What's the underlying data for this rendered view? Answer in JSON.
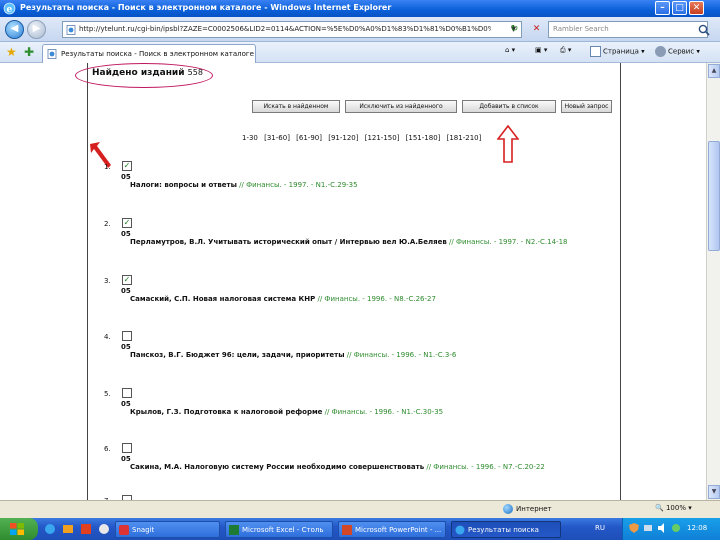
{
  "window": {
    "title": "Результаты поиска - Поиск в электронном каталоге - Windows Internet Explorer"
  },
  "address": {
    "url": "http://ytelunt.ru/cgi-bin/ipsbl?ZAZE=C0002506&LID2=0114&ACTION=%5E%D0%A0%D1%83%D1%81%D0%B1%D0%BE",
    "search_placeholder": "Rambler Search"
  },
  "tab": {
    "label": "Результаты поиска - Поиск в электронном каталоге"
  },
  "command_bar": {
    "page_label": "Страница",
    "tools_label": "Сервис"
  },
  "page": {
    "found_label": "Найдено изданий",
    "found_count": "558",
    "buttons": [
      {
        "label": "Искать в найденном"
      },
      {
        "label": "Исключить из найденного"
      },
      {
        "label": "Добавить в список"
      },
      {
        "label": "Новый запрос"
      }
    ],
    "pages": [
      "1-30",
      "[31-60]",
      "[61-90]",
      "[91-120]",
      "[121-150]",
      "[151-180]",
      "[181-210]"
    ],
    "records": [
      {
        "num": "1.",
        "checked": true,
        "code": "05",
        "text": "Налоги: вопросы и ответы",
        "source": " // Финансы. - 1997. - N1.-С.29-35"
      },
      {
        "num": "2.",
        "checked": true,
        "code": "05",
        "text": "Перламутров, В.Л. Учитывать исторический опыт / Интервью вел Ю.А.Беляев",
        "source": " // Финансы. - 1997. - N2.-С.14-18"
      },
      {
        "num": "3.",
        "checked": true,
        "code": "05",
        "text": "Самаский, С.П. Новая налоговая система КНР",
        "source": " // Финансы. - 1996. - N8.-С.26-27"
      },
      {
        "num": "4.",
        "checked": false,
        "code": "05",
        "text": "Панскоз, В.Г. Бюджет 96: цели, задачи, приоритеты",
        "source": " // Финансы. - 1996. - N1.-С.3-6"
      },
      {
        "num": "5.",
        "checked": false,
        "code": "05",
        "text": "Крылов, Г.З. Подготовка к налоговой реформе",
        "source": " // Финансы. - 1996. - N1.-С.30-35"
      },
      {
        "num": "6.",
        "checked": false,
        "code": "05",
        "text": "Сакина, М.А. Налоговую систему России необходимо совершенствовать",
        "source": " // Финансы. - 1996. - N7.-С.20-22"
      },
      {
        "num": "7.",
        "checked": false,
        "code": "",
        "text": "",
        "source": ""
      }
    ]
  },
  "status": {
    "zone": "Интернет",
    "zoom": "100%"
  },
  "taskbar": {
    "tasks": [
      {
        "label": "Snagit",
        "active": false
      },
      {
        "label": "Microsoft Excel - Столь",
        "active": false
      },
      {
        "label": "Microsoft PowerPoint - ...",
        "active": false
      },
      {
        "label": "Результаты поиска",
        "active": true
      }
    ],
    "lang": "RU",
    "clock": "12:08"
  },
  "colors": {
    "accent_pink": "#c0165e",
    "arrow_red": "#d62020",
    "source_green": "#2e8b2e"
  }
}
